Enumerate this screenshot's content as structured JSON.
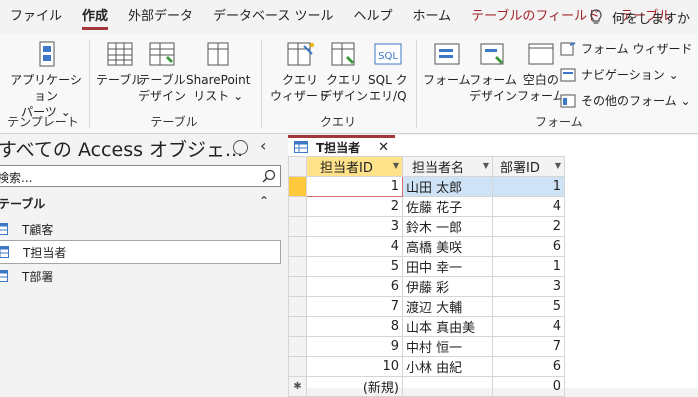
{
  "tabs": [
    {
      "label": "ファイル",
      "active": false,
      "contextual": false
    },
    {
      "label": "作成",
      "active": true,
      "contextual": false
    },
    {
      "label": "外部データ",
      "active": false,
      "contextual": false
    },
    {
      "label": "データベース ツール",
      "active": false,
      "contextual": false
    },
    {
      "label": "ヘルプ",
      "active": false,
      "contextual": false
    },
    {
      "label": "ホーム",
      "active": false,
      "contextual": false
    },
    {
      "label": "テーブルのフィールド",
      "active": false,
      "contextual": true
    },
    {
      "label": "テーブル",
      "active": false,
      "contextual": true
    }
  ],
  "tell_me": "何をしますか",
  "ribbon": {
    "templates": {
      "button": "アプリケーション\nパーツ ⌄",
      "group": "テンプレート"
    },
    "tables": {
      "table": "テーブル",
      "design": "テーブル\nデザイン",
      "sharepoint": "SharePoint\nリスト ⌄",
      "group": "テーブル"
    },
    "queries": {
      "wizard": "クエリ\nウィザード",
      "design": "クエリ\nデザイン",
      "sql": "SQL ク\nエリ/Q",
      "group": "クエリ"
    },
    "forms": {
      "form": "フォーム",
      "design": "フォーム\nデザイン",
      "blank": "空白の\nフォーム",
      "wizard": "フォーム ウィザード",
      "navigation": "ナビゲーション ⌄",
      "more": "その他のフォーム ⌄",
      "group": "フォーム"
    }
  },
  "nav": {
    "title": "すべての Access オブジェ...",
    "search_placeholder": "検索...",
    "section": "テーブル",
    "items": [
      "T顧客",
      "T担当者",
      "T部署"
    ],
    "selected_index": 1
  },
  "doc_tab": "T担当者",
  "grid": {
    "columns": [
      "担当者ID",
      "担当者名",
      "部署ID"
    ],
    "rows": [
      [
        "1",
        "山田 太郎",
        "1"
      ],
      [
        "2",
        "佐藤 花子",
        "4"
      ],
      [
        "3",
        "鈴木 一郎",
        "2"
      ],
      [
        "4",
        "高橋 美咲",
        "6"
      ],
      [
        "5",
        "田中 幸一",
        "1"
      ],
      [
        "6",
        "伊藤 彩",
        "3"
      ],
      [
        "7",
        "渡辺 大輔",
        "5"
      ],
      [
        "8",
        "山本 真由美",
        "4"
      ],
      [
        "9",
        "中村 恒一",
        "7"
      ],
      [
        "10",
        "小林 由紀",
        "6"
      ]
    ],
    "new_row": {
      "marker": "✱",
      "id": "(新規)",
      "dept": "0"
    }
  },
  "colors": {
    "accent": "#a4373a",
    "contextual": "#a4262c",
    "highlight": "#cfe3f7"
  }
}
